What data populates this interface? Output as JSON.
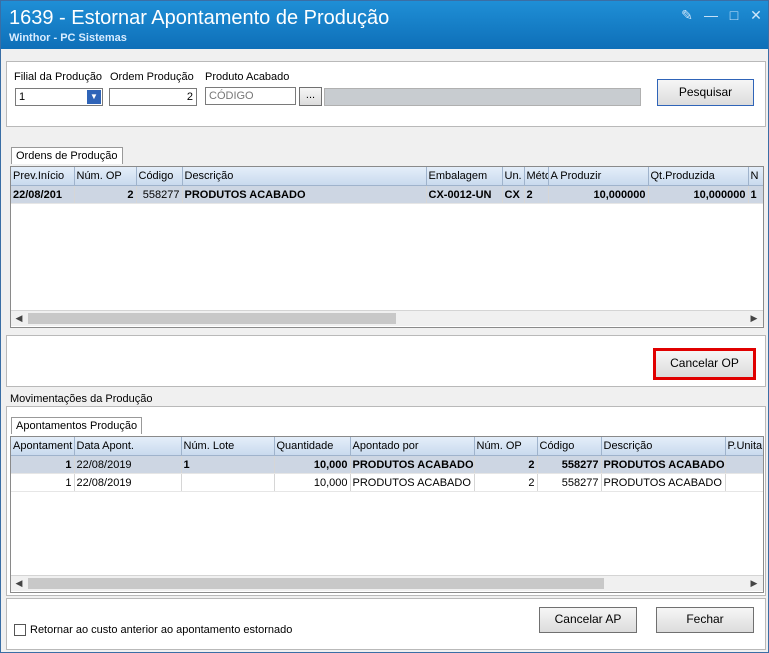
{
  "window": {
    "title": "1639 - Estornar Apontamento de Produção",
    "subtitle": "Winthor - PC Sistemas"
  },
  "filter": {
    "filial_label": "Filial da Produção",
    "filial_value": "1",
    "ordem_label": "Ordem Produção",
    "ordem_value": "2",
    "produto_label": "Produto Acabado",
    "produto_placeholder": "CÓDIGO",
    "produto_browse": "...",
    "produto_desc": "",
    "search_button": "Pesquisar"
  },
  "ordens": {
    "tab_label": "Ordens de Produção",
    "columns": [
      "Prev.Início",
      "Núm. OP",
      "Código",
      "Descrição",
      "Embalagem",
      "Un.",
      "Méto",
      "A Produzir",
      "Qt.Produzida",
      "N"
    ],
    "rows": [
      [
        "22/08/201",
        "2",
        "558277",
        "PRODUTOS ACABADO",
        "CX-0012-UN",
        "CX",
        "2",
        "10,000000",
        "10,000000",
        "1"
      ]
    ],
    "cancel_op_button": "Cancelar OP"
  },
  "movimentacoes": {
    "section_label": "Movimentações da Produção",
    "tab_label": "Apontamentos Produção",
    "columns": [
      "Apontament",
      "Data Apont.",
      "Núm. Lote",
      "Quantidade",
      "Apontado por",
      "Núm. OP",
      "Código",
      "Descrição",
      "P.Unita"
    ],
    "rows": [
      [
        "1",
        "22/08/2019",
        "1",
        "10,000",
        "PRODUTOS ACABADO",
        "2",
        "558277",
        "PRODUTOS ACABADO",
        ""
      ],
      [
        "1",
        "22/08/2019",
        "",
        "10,000",
        "PRODUTOS ACABADO",
        "2",
        "558277",
        "PRODUTOS ACABADO",
        ""
      ]
    ]
  },
  "footer": {
    "checkbox_label": "Retornar ao custo anterior ao apontamento estornado",
    "cancel_ap_button": "Cancelar AP",
    "close_button": "Fechar"
  },
  "colors": {
    "title_bar": "#1f8fd6",
    "highlight_border": "#e00000",
    "selected_row": "#cdd6e3"
  }
}
